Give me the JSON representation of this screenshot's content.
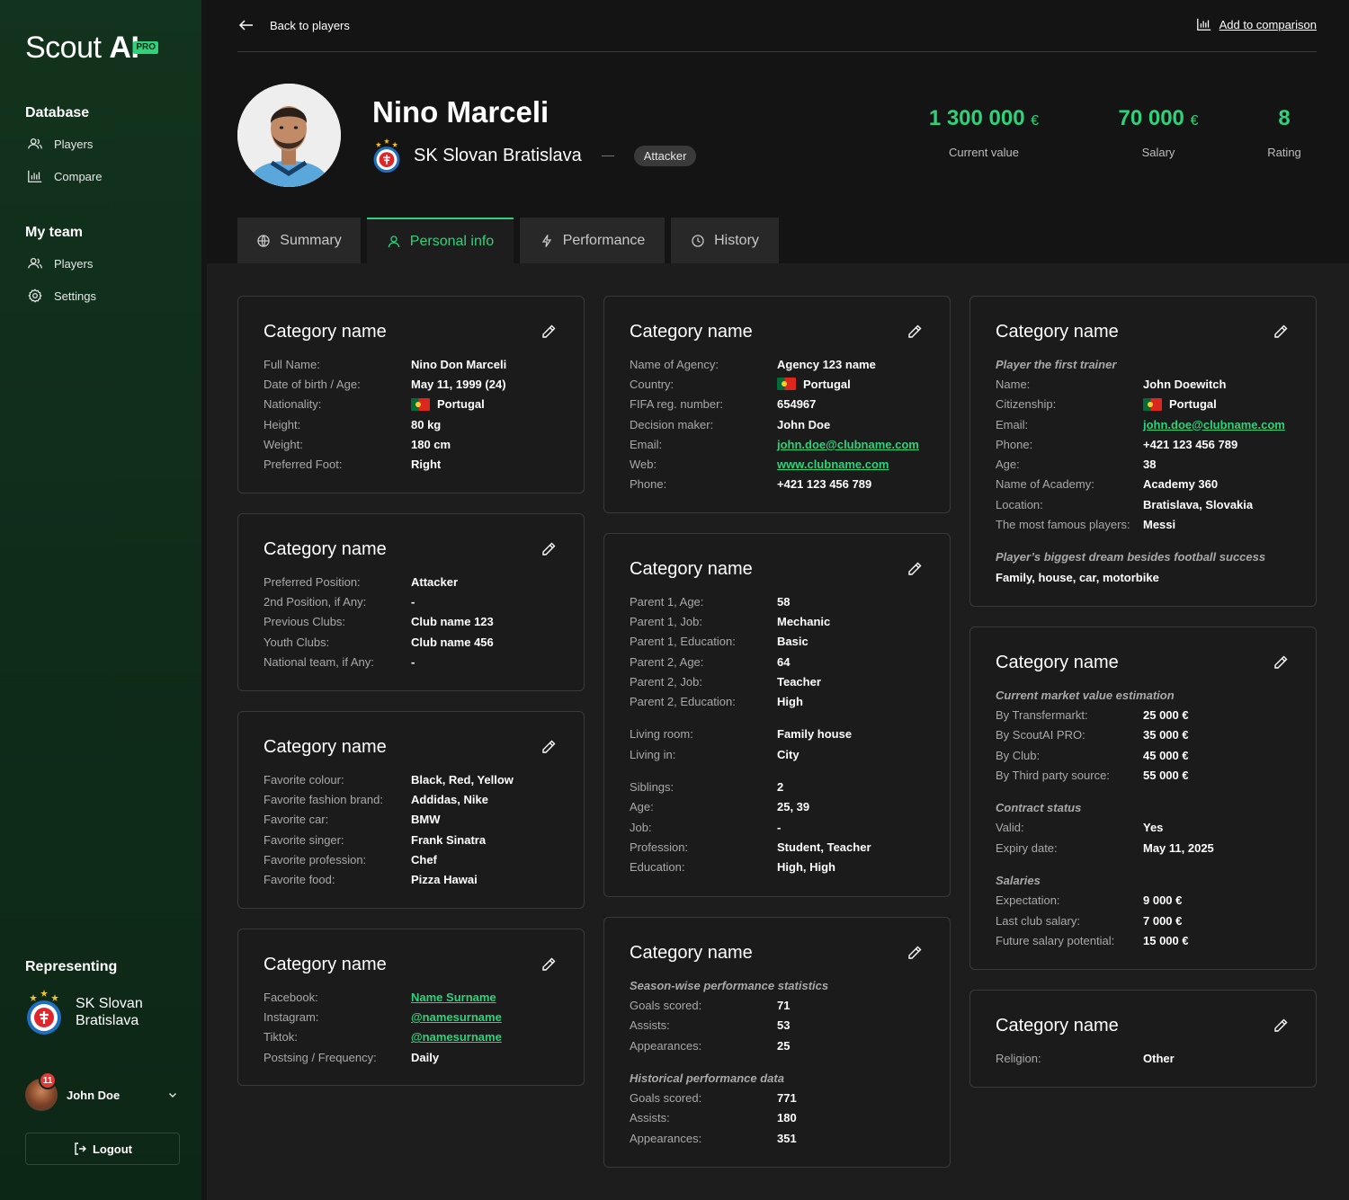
{
  "sidebar": {
    "logo_word": "Scout ",
    "logo_ai": "AI",
    "logo_badge": "PRO",
    "database_heading": "Database",
    "database_items": [
      "Players",
      "Compare"
    ],
    "myteam_heading": "My team",
    "myteam_items": [
      "Players",
      "Settings"
    ],
    "representing_heading": "Representing",
    "representing_club": "SK Slovan Bratislava",
    "user_name": "John Doe",
    "notification_count": "11",
    "logout_label": "Logout"
  },
  "header": {
    "back_label": "Back to players",
    "compare_label": "Add to comparison",
    "player_name": "Nino Marceli",
    "club_name": "SK Slovan Bratislava",
    "position_badge": "Attacker",
    "stats": [
      {
        "value": "1 300 000",
        "unit": "€",
        "label": "Current value"
      },
      {
        "value": "70 000",
        "unit": "€",
        "label": "Salary"
      },
      {
        "value": "8",
        "unit": "",
        "label": "Rating"
      }
    ]
  },
  "tabs": [
    "Summary",
    "Personal info",
    "Performance",
    "History"
  ],
  "active_tab": "Personal info",
  "accent_color": "#2fd27a",
  "cards": {
    "c1": {
      "title": "Category name",
      "rows": [
        [
          "Full Name:",
          "Nino Don Marceli"
        ],
        [
          "Date of birth / Age:",
          "May 11, 1999  (24)"
        ],
        [
          "Nationality:",
          "Portugal"
        ],
        [
          "Height:",
          "80 kg"
        ],
        [
          "Weight:",
          "180 cm"
        ],
        [
          "Preferred Foot:",
          "Right"
        ]
      ]
    },
    "c2": {
      "title": "Category name",
      "rows": [
        [
          "Preferred Position:",
          "Attacker"
        ],
        [
          "2nd Position, if Any:",
          "-"
        ],
        [
          "Previous Clubs:",
          "Club name 123"
        ],
        [
          "Youth Clubs:",
          "Club name 456"
        ],
        [
          "National team, if Any:",
          "-"
        ]
      ]
    },
    "c3": {
      "title": "Category name",
      "rows": [
        [
          "Favorite colour:",
          "Black, Red, Yellow"
        ],
        [
          "Favorite fashion brand:",
          "Addidas, Nike"
        ],
        [
          "Favorite car:",
          "BMW"
        ],
        [
          "Favorite singer:",
          "Frank Sinatra"
        ],
        [
          "Favorite profession:",
          "Chef"
        ],
        [
          "Favorite food:",
          "Pizza Hawai"
        ]
      ]
    },
    "c4": {
      "title": "Category name",
      "rows": [
        [
          "Facebook:",
          "Name Surname"
        ],
        [
          "Instagram:",
          "@namesurname"
        ],
        [
          "Tiktok:",
          "@namesurname"
        ],
        [
          "Postsing / Frequency:",
          "Daily"
        ]
      ]
    },
    "c5": {
      "title": "Category name",
      "rows": [
        [
          "Name of Agency:",
          "Agency 123 name"
        ],
        [
          "Country:",
          "Portugal"
        ],
        [
          "FIFA reg. number:",
          "654967"
        ],
        [
          "Decision maker:",
          "John Doe"
        ],
        [
          "Email:",
          "john.doe@clubname.com"
        ],
        [
          "Web:",
          "www.clubname.com"
        ],
        [
          "Phone:",
          "+421 123 456 789"
        ]
      ]
    },
    "c6": {
      "title": "Category name",
      "parents": [
        [
          "Parent 1, Age:",
          "58"
        ],
        [
          "Parent 1, Job:",
          "Mechanic"
        ],
        [
          "Parent 1, Education:",
          "Basic"
        ],
        [
          "Parent 2, Age:",
          "64"
        ],
        [
          "Parent 2, Job:",
          "Teacher"
        ],
        [
          "Parent 2, Education:",
          "High"
        ]
      ],
      "living": [
        [
          "Living room:",
          "Family house"
        ],
        [
          "Living in:",
          "City"
        ]
      ],
      "siblings": [
        [
          "Siblings:",
          "2"
        ],
        [
          "Age:",
          "25, 39"
        ],
        [
          "Job:",
          "-"
        ],
        [
          "Profession:",
          "Student, Teacher"
        ],
        [
          "Education:",
          "High, High"
        ]
      ]
    },
    "c7": {
      "title": "Category name",
      "season_heading": "Season-wise performance statistics",
      "season": [
        [
          "Goals scored:",
          "71"
        ],
        [
          "Assists:",
          "53"
        ],
        [
          "Appearances:",
          "25"
        ]
      ],
      "historical_heading": "Historical performance data",
      "historical": [
        [
          "Goals scored:",
          "771"
        ],
        [
          "Assists:",
          "180"
        ],
        [
          "Appearances:",
          "351"
        ]
      ]
    },
    "c8": {
      "title": "Category name",
      "trainer_heading": "Player the first trainer",
      "rows": [
        [
          "Name:",
          "John Doewitch"
        ],
        [
          "Citizenship:",
          "Portugal"
        ],
        [
          "Email:",
          "john.doe@clubname.com"
        ],
        [
          "Phone:",
          "+421 123 456 789"
        ],
        [
          "Age:",
          "38"
        ],
        [
          "Name of Academy:",
          "Academy 360"
        ],
        [
          "Location:",
          "Bratislava, Slovakia"
        ],
        [
          "The most famous players:",
          "Messi"
        ]
      ],
      "dream_heading": "Player’s biggest dream besides football success",
      "dream_value": "Family, house, car, motorbike"
    },
    "c9": {
      "title": "Category name",
      "market_heading": "Current market value estimation",
      "market": [
        [
          "By Transfermarkt:",
          "25 000 €"
        ],
        [
          "By ScoutAI PRO:",
          "35 000 €"
        ],
        [
          "By Club:",
          "45 000 €"
        ],
        [
          "By Third party source:",
          "55 000 €"
        ]
      ],
      "contract_heading": "Contract status",
      "contract": [
        [
          "Valid:",
          "Yes"
        ],
        [
          "Expiry date:",
          "May 11, 2025"
        ]
      ],
      "salaries_heading": "Salaries",
      "salaries": [
        [
          "Expectation:",
          "9 000 €"
        ],
        [
          "Last club salary:",
          "7 000 €"
        ],
        [
          "Future salary potential:",
          "15 000 €"
        ]
      ]
    },
    "c10": {
      "title": "Category name",
      "rows": [
        [
          "Religion:",
          "Other"
        ]
      ]
    }
  }
}
